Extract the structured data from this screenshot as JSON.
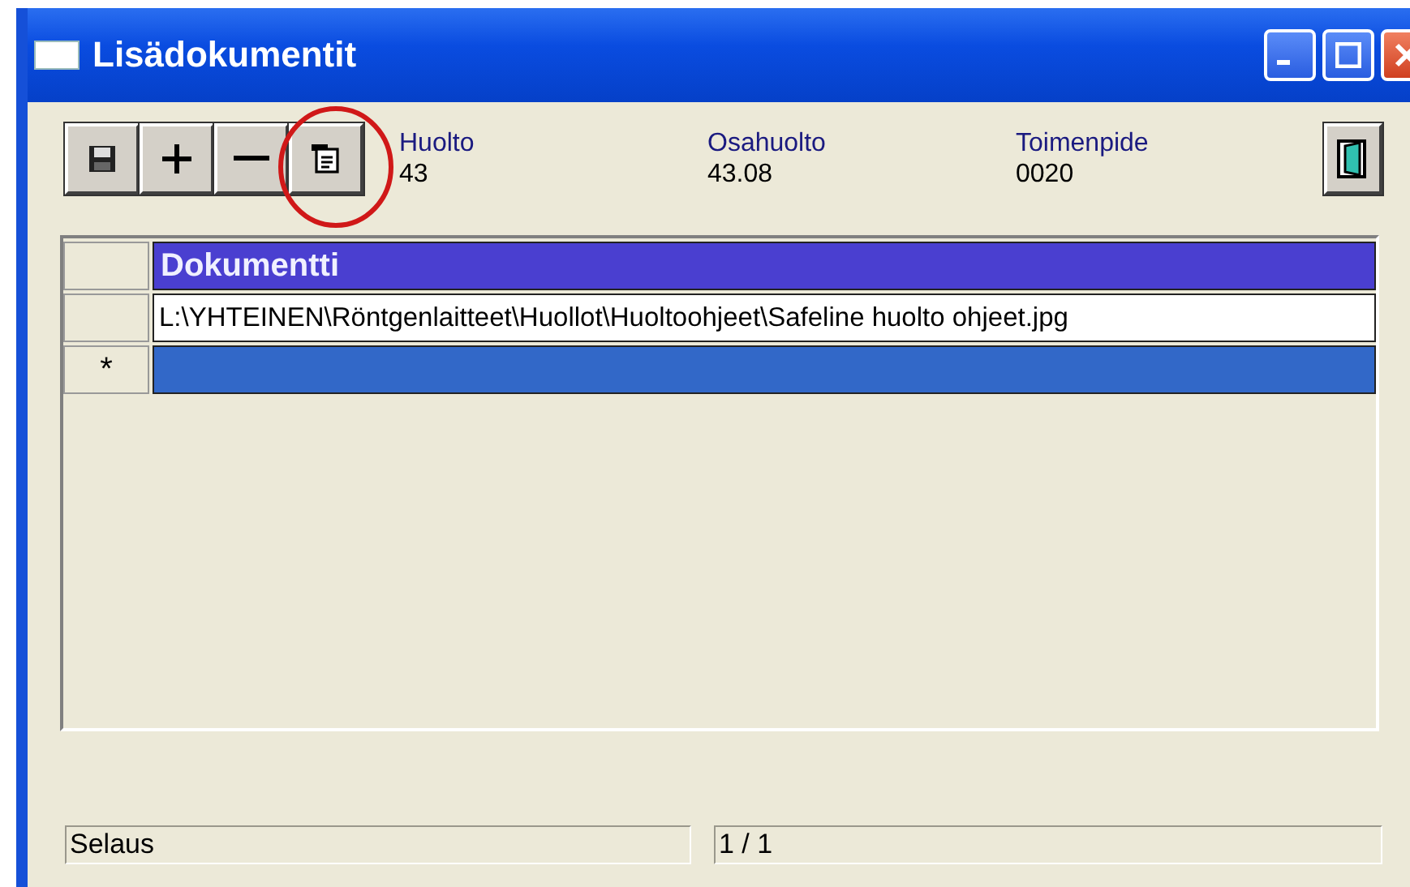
{
  "window": {
    "title": "Lisädokumentit"
  },
  "toolbar": {
    "fields": [
      {
        "label": "Huolto",
        "value": "43"
      },
      {
        "label": "Osahuolto",
        "value": "43.08"
      },
      {
        "label": "Toimenpide",
        "value": "0020"
      }
    ]
  },
  "grid": {
    "columns": [
      "Dokumentti"
    ],
    "rows": [
      {
        "kind": "record",
        "cells": [
          "L:\\YHTEINEN\\Röntgenlaitteet\\Huollot\\Huoltoohjeet\\Safeline huolto ohjeet.jpg"
        ]
      },
      {
        "kind": "new",
        "marker": "*",
        "cells": [
          ""
        ]
      }
    ]
  },
  "status_bar": [
    "Selaus",
    "1 / 1"
  ]
}
